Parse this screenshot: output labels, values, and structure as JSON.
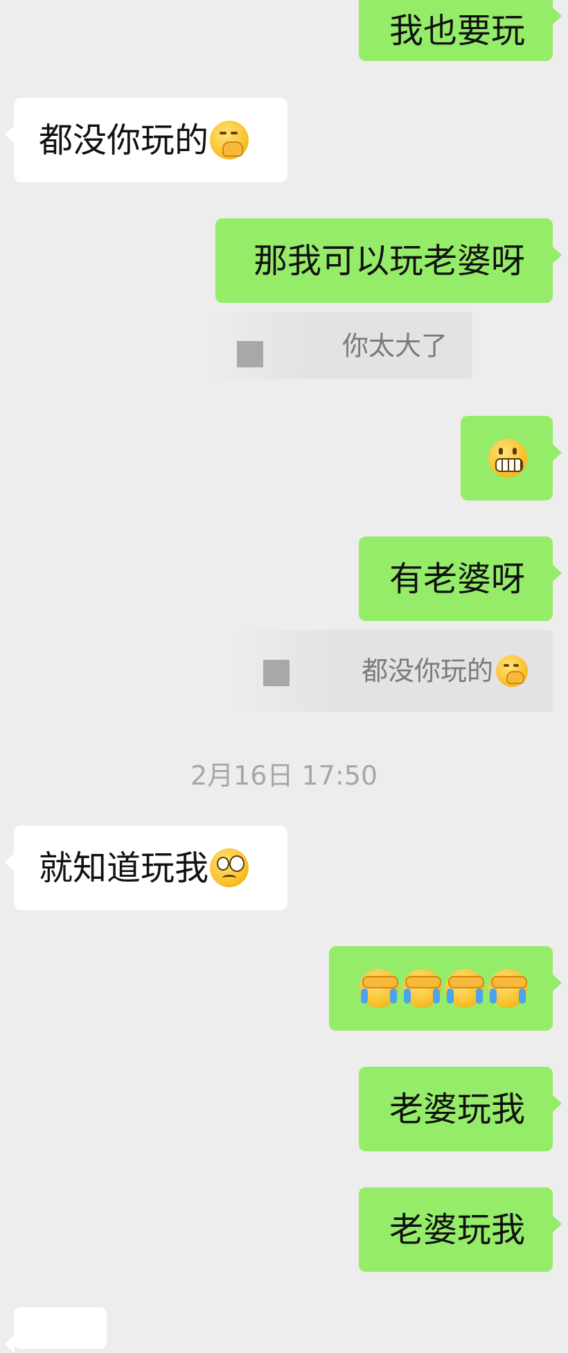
{
  "messages": {
    "m1": {
      "text": "我也要玩"
    },
    "m2": {
      "text": "都没你玩的",
      "emoji": "thinking-face-icon"
    },
    "m3": {
      "text": "那我可以玩老婆呀"
    },
    "q1": {
      "text": "你太大了"
    },
    "m4": {
      "emoji": "grimacing-face-icon"
    },
    "m5": {
      "text": "有老婆呀"
    },
    "q2": {
      "text": "都没你玩的",
      "emoji": "thinking-face-icon"
    },
    "m6": {
      "text": "就知道玩我",
      "emoji": "flushed-face-icon"
    },
    "m7": {
      "emojis": [
        "face-palm-crying-icon",
        "face-palm-crying-icon",
        "face-palm-crying-icon",
        "face-palm-crying-icon"
      ]
    },
    "m8": {
      "text": "老婆玩我"
    },
    "m9": {
      "text": "老婆玩我"
    }
  },
  "timestamp": "2月16日 17:50",
  "colors": {
    "background": "#ededed",
    "sent_bubble": "#95ec69",
    "received_bubble": "#ffffff",
    "quote_bg": "#e3e3e3",
    "timestamp_text": "#a6a6a6"
  }
}
